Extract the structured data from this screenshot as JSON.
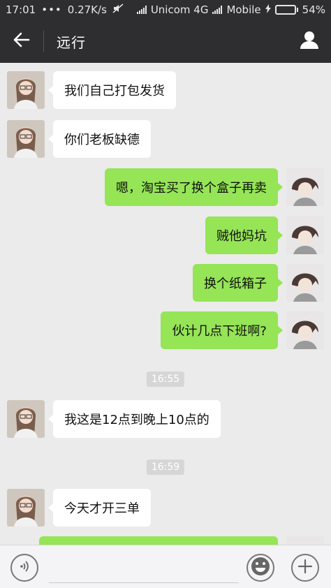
{
  "status_bar": {
    "time": "17:01",
    "net_speed": "0.27K/s",
    "carrier1": "Unicom 4G",
    "carrier2": "Mobile",
    "battery": "54%",
    "battery_level": 0.54
  },
  "header": {
    "title": "远行",
    "back_icon": "arrow-left-icon",
    "profile_icon": "person-icon"
  },
  "messages": [
    {
      "side": "received",
      "text": "我们自己打包发货"
    },
    {
      "side": "received",
      "text": "你们老板缺德"
    },
    {
      "side": "sent",
      "text": "嗯，淘宝买了换个盒子再卖"
    },
    {
      "side": "sent",
      "text": "贼他妈坑"
    },
    {
      "side": "sent",
      "text": "换个纸箱子"
    },
    {
      "side": "sent",
      "text": "伙计几点下班啊?"
    },
    {
      "side": "time",
      "text": "16:55"
    },
    {
      "side": "received",
      "text": "我这是12点到晚上10点的"
    },
    {
      "side": "time",
      "text": "16:59"
    },
    {
      "side": "received",
      "text": "今天才开三单"
    },
    {
      "side": "sent",
      "text": ""
    }
  ],
  "input_bar": {
    "voice_icon": "voice-icon",
    "text_value": "",
    "emoji_icon": "smiley-icon",
    "plus_icon": "plus-icon"
  },
  "colors": {
    "header_bg": "#2e2e30",
    "chat_bg": "#ebebeb",
    "sent_bubble": "#95e556",
    "received_bubble": "#ffffff",
    "battery_fill": "#4cd964"
  }
}
